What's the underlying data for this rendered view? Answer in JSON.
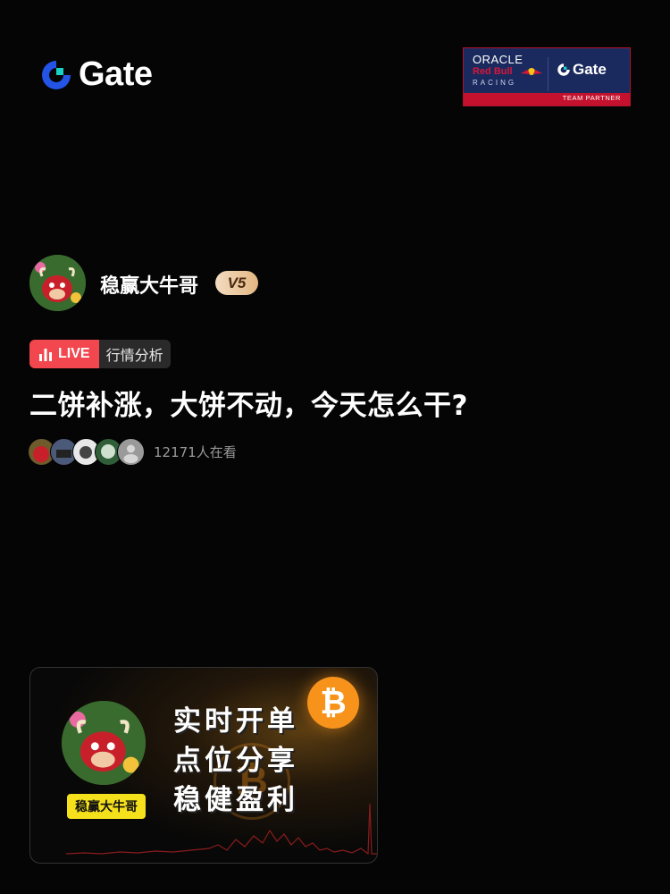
{
  "brand": {
    "name": "Gate",
    "accent": "#2354e6",
    "accent_light": "#19d0c6"
  },
  "partner": {
    "line1": "ORACLE",
    "line2": "Red Bull",
    "line3": "RACING",
    "brand": "Gate",
    "tagline": "TEAM PARTNER",
    "bg_color": "#1b2a5e",
    "band_color": "#c4122e"
  },
  "streamer": {
    "name": "稳赢大牛哥",
    "level": "V5"
  },
  "tags": {
    "live": "LIVE",
    "category": "行情分析"
  },
  "stream": {
    "title": "二饼补涨，大饼不动，今天怎么干?",
    "viewers": "12171人在看"
  },
  "card": {
    "name_tag": "稳赢大牛哥",
    "lines": [
      "实时开单",
      "点位分享",
      "稳健盈利"
    ],
    "coin_symbol": "₿",
    "accent": "#f7931a"
  }
}
